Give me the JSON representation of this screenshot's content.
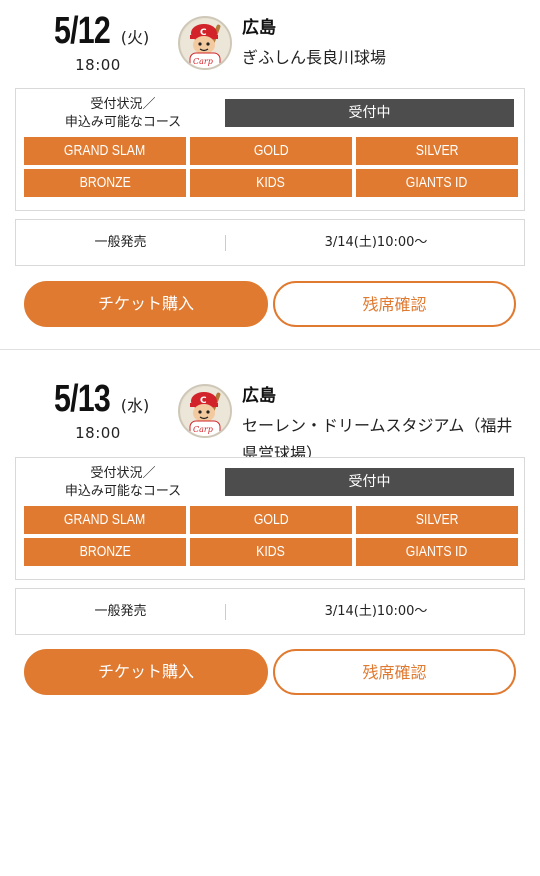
{
  "games": [
    {
      "date": "5/12",
      "dow": "(火)",
      "time": "18:00",
      "logo_icon": "carp-mascot-logo",
      "team": "広島",
      "venue": "ぎふしん長良川球場",
      "status_label": "受付状況／\n申込み可能なコース",
      "status_value": "受付中",
      "courses": [
        "GRAND SLAM",
        "GOLD",
        "SILVER",
        "BRONZE",
        "KIDS",
        "GIANTS ID"
      ],
      "sale_type": "一般発売",
      "sale_date": "3/14(土)10:00〜",
      "buy_label": "チケット購入",
      "seats_label": "残席確認"
    },
    {
      "date": "5/13",
      "dow": "(水)",
      "time": "18:00",
      "logo_icon": "carp-mascot-logo",
      "team": "広島",
      "venue": "セーレン・ドリームスタジアム（福井県営球場）",
      "status_label": "受付状況／\n申込み可能なコース",
      "status_value": "受付中",
      "courses": [
        "GRAND SLAM",
        "GOLD",
        "SILVER",
        "BRONZE",
        "KIDS",
        "GIANTS ID"
      ],
      "sale_type": "一般発売",
      "sale_date": "3/14(土)10:00〜",
      "buy_label": "チケット購入",
      "seats_label": "残席確認"
    }
  ],
  "colors": {
    "accent": "#e07a30",
    "status_bg": "#4d4d4d",
    "border": "#d9d9d9"
  }
}
